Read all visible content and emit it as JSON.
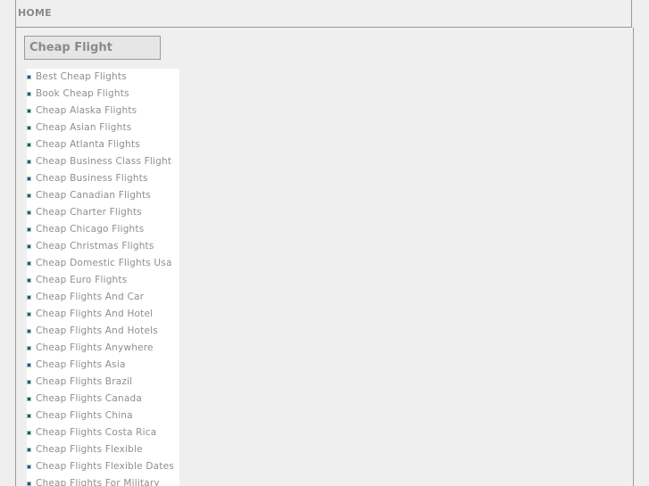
{
  "nav": {
    "home_label": "HOME"
  },
  "section": {
    "title": "Cheap Flight"
  },
  "links": [
    "Best Cheap Flights",
    "Book Cheap Flights",
    "Cheap Alaska Flights",
    "Cheap Asian Flights",
    "Cheap Atlanta Flights",
    "Cheap Business Class Flight",
    "Cheap Business Flights",
    "Cheap Canadian Flights",
    "Cheap Charter Flights",
    "Cheap Chicago Flights",
    "Cheap Christmas Flights",
    "Cheap Domestic Flights Usa",
    "Cheap Euro Flights",
    "Cheap Flights And Car",
    "Cheap Flights And Hotel",
    "Cheap Flights And Hotels",
    "Cheap Flights Anywhere",
    "Cheap Flights Asia",
    "Cheap Flights Brazil",
    "Cheap Flights Canada",
    "Cheap Flights China",
    "Cheap Flights Costa Rica",
    "Cheap Flights Flexible",
    "Cheap Flights Flexible Dates",
    "Cheap Flights For Military"
  ],
  "colors": {
    "background": "#efefef",
    "border": "#9a9a9a",
    "text": "#8e8e8e",
    "bullet": "#1f5c63"
  }
}
